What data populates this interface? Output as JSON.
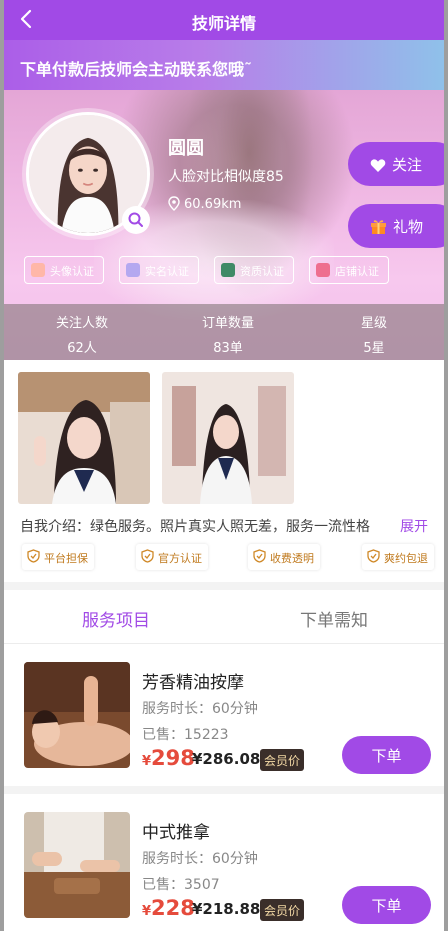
{
  "header": {
    "title": "技师详情"
  },
  "notice": {
    "text": "下单付款后技师会主动联系您哦˜"
  },
  "profile": {
    "name": "圆圆",
    "similarity": "人脸对比相似度85",
    "distance": "60.69km",
    "follow_label": "关注",
    "gift_label": "礼物",
    "certifications": [
      "头像认证",
      "实名认证",
      "资质认证",
      "店铺认证"
    ]
  },
  "stats": [
    {
      "label": "关注人数",
      "value": "62人"
    },
    {
      "label": "订单数量",
      "value": "83单"
    },
    {
      "label": "星级",
      "value": "5星"
    }
  ],
  "intro": {
    "text": "自我介绍：绿色服务。照片真实人照无差，服务一流性格",
    "more": "展开"
  },
  "guarantees": [
    "平台担保",
    "官方认证",
    "收费透明",
    "爽约包退"
  ],
  "tabs": [
    {
      "label": "服务项目",
      "active": true
    },
    {
      "label": "下单需知",
      "active": false
    }
  ],
  "services": [
    {
      "name": "芳香精油按摩",
      "duration": "服务时长：60分钟",
      "sold": "已售：15223",
      "currency": "¥",
      "price": "298",
      "member_price": "¥286.08",
      "member_tag": "会员价",
      "order_label": "下单"
    },
    {
      "name": "中式推拿",
      "duration": "服务时长：60分钟",
      "sold": "已售：3507",
      "currency": "¥",
      "price": "228",
      "member_price": "¥218.88",
      "member_tag": "会员价",
      "order_label": "下单"
    }
  ],
  "colors": {
    "accent": "#a14ae6",
    "price": "#e54b3c",
    "badge_text": "#c07a1e"
  }
}
